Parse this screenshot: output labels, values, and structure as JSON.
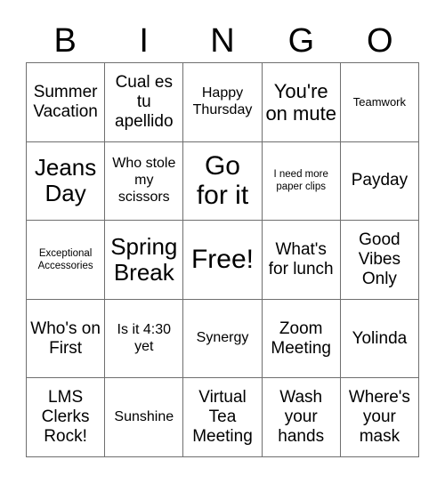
{
  "card": {
    "type": "bingo-card",
    "columns": 5,
    "rows": 5,
    "background_color": "#ffffff",
    "text_color": "#000000",
    "border_color": "#6f6f6f"
  },
  "header": {
    "letters": [
      {
        "label": "B"
      },
      {
        "label": "I"
      },
      {
        "label": "N"
      },
      {
        "label": "G"
      },
      {
        "label": "O"
      }
    ]
  },
  "grid": {
    "cells": [
      {
        "text": "Summer Vacation",
        "size": "sz-md",
        "free": false
      },
      {
        "text": "Cual es tu apellido",
        "size": "sz-md",
        "free": false
      },
      {
        "text": "Happy Thursday",
        "size": "sz-sm",
        "free": false
      },
      {
        "text": "You're on mute",
        "size": "sz-lg",
        "free": false
      },
      {
        "text": "Teamwork",
        "size": "sz-xs",
        "free": false
      },
      {
        "text": "Jeans Day",
        "size": "sz-xl",
        "free": false
      },
      {
        "text": "Who stole my scissors",
        "size": "sz-sm",
        "free": false
      },
      {
        "text": "Go for it",
        "size": "sz-xxl",
        "free": false
      },
      {
        "text": "I need more paper clips",
        "size": "sz-xxs",
        "free": false
      },
      {
        "text": "Payday",
        "size": "sz-md",
        "free": false
      },
      {
        "text": "Exceptional Accessories",
        "size": "sz-xxs",
        "free": false
      },
      {
        "text": "Spring Break",
        "size": "sz-xl",
        "free": false
      },
      {
        "text": "Free!",
        "size": "sz-xxl",
        "free": true
      },
      {
        "text": "What's for lunch",
        "size": "sz-md",
        "free": false
      },
      {
        "text": "Good Vibes Only",
        "size": "sz-md",
        "free": false
      },
      {
        "text": "Who's on First",
        "size": "sz-md",
        "free": false
      },
      {
        "text": "Is it 4:30 yet",
        "size": "sz-sm",
        "free": false
      },
      {
        "text": "Synergy",
        "size": "sz-sm",
        "free": false
      },
      {
        "text": "Zoom Meeting",
        "size": "sz-md",
        "free": false
      },
      {
        "text": "Yolinda",
        "size": "sz-md",
        "free": false
      },
      {
        "text": "LMS Clerks Rock!",
        "size": "sz-md",
        "free": false
      },
      {
        "text": "Sunshine",
        "size": "sz-sm",
        "free": false
      },
      {
        "text": "Virtual Tea Meeting",
        "size": "sz-md",
        "free": false
      },
      {
        "text": "Wash your hands",
        "size": "sz-md",
        "free": false
      },
      {
        "text": "Where's your mask",
        "size": "sz-md",
        "free": false
      }
    ]
  }
}
